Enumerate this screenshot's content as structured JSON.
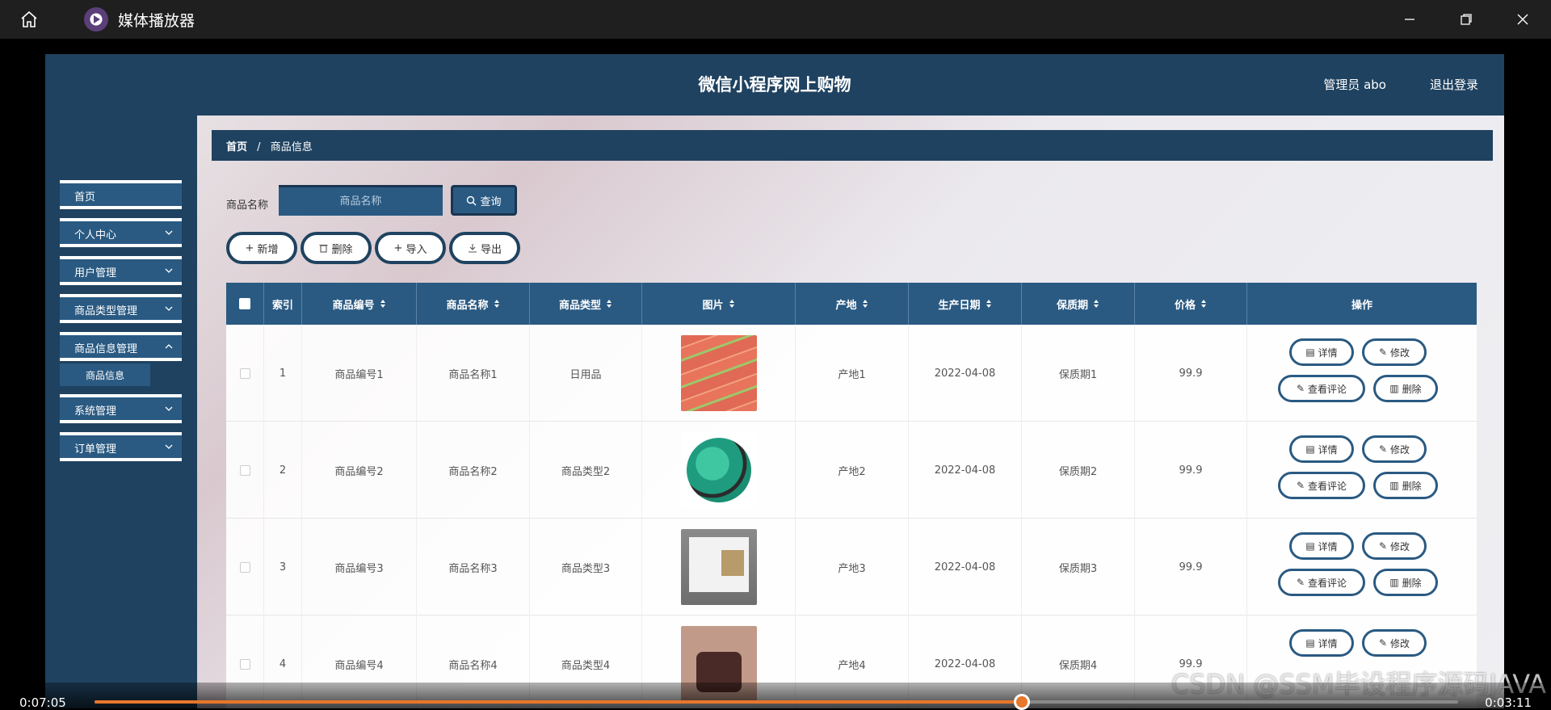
{
  "player": {
    "title": "媒体播放器",
    "time_current": "0:07:05",
    "time_remaining": "0:03:11",
    "progress": 0.68,
    "watermark": "CSDN @SSM毕设程序源码JAVA"
  },
  "header": {
    "title": "微信小程序网上购物",
    "user": "管理员 abo",
    "logout": "退出登录"
  },
  "sidebar": {
    "items": [
      {
        "label": "首页",
        "has_chevron": false
      },
      {
        "label": "个人中心",
        "has_chevron": true
      },
      {
        "label": "用户管理",
        "has_chevron": true
      },
      {
        "label": "商品类型管理",
        "has_chevron": true
      },
      {
        "label": "商品信息管理",
        "has_chevron": true,
        "expanded": true
      },
      {
        "label": "系统管理",
        "has_chevron": true
      },
      {
        "label": "订单管理",
        "has_chevron": true
      }
    ],
    "sub_item": "商品信息"
  },
  "breadcrumb": {
    "home": "首页",
    "separator": "/",
    "current": "商品信息"
  },
  "search": {
    "label": "商品名称",
    "placeholder": "商品名称",
    "button": "查询"
  },
  "actions": {
    "add": "新增",
    "delete": "删除",
    "import": "导入",
    "export": "导出"
  },
  "table": {
    "columns": [
      "索引",
      "商品编号",
      "商品名称",
      "商品类型",
      "图片",
      "产地",
      "生产日期",
      "保质期",
      "价格",
      "操作"
    ],
    "rows": [
      {
        "index": "1",
        "code": "商品编号1",
        "name": "商品名称1",
        "type": "日用品",
        "image": "sausage-photo",
        "origin": "产地1",
        "date": "2022-04-08",
        "shelf": "保质期1",
        "price": "99.9"
      },
      {
        "index": "2",
        "code": "商品编号2",
        "name": "商品名称2",
        "type": "商品类型2",
        "image": "football-photo",
        "origin": "产地2",
        "date": "2022-04-08",
        "shelf": "保质期2",
        "price": "99.9"
      },
      {
        "index": "3",
        "code": "商品编号3",
        "name": "商品名称3",
        "type": "商品类型3",
        "image": "book-photo",
        "origin": "产地3",
        "date": "2022-04-08",
        "shelf": "保质期3",
        "price": "99.9"
      },
      {
        "index": "4",
        "code": "商品编号4",
        "name": "商品名称4",
        "type": "商品类型4",
        "image": "handbag-photo",
        "origin": "产地4",
        "date": "2022-04-08",
        "shelf": "保质期4",
        "price": "99.9"
      }
    ],
    "row_actions": {
      "detail": "详情",
      "edit": "修改",
      "comments": "查看评论",
      "delete": "删除"
    }
  },
  "colors": {
    "header": "#1f4260",
    "accent": "#2a5a82",
    "progress": "#e8762b"
  }
}
